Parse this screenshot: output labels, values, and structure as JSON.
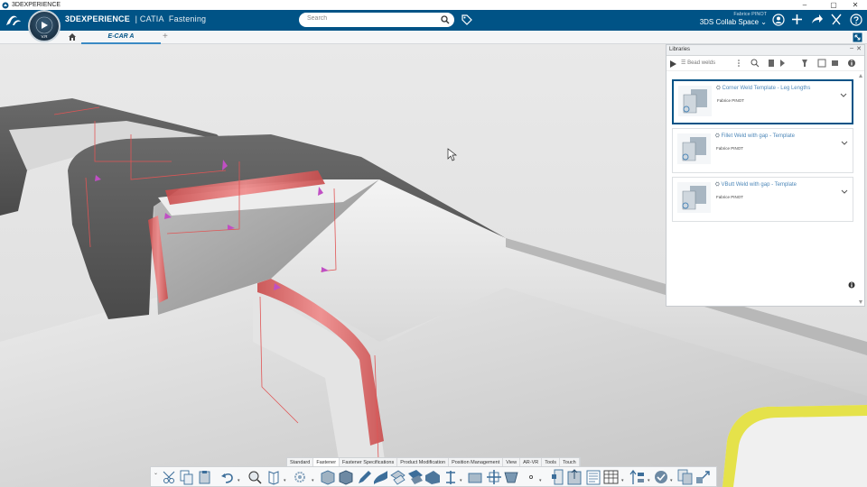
{
  "os_bar": {
    "title": "3DEXPERIENCE",
    "controls": [
      "–",
      "▢",
      "✕"
    ]
  },
  "header": {
    "brand_3d": "3D",
    "brand_experience": "EXPERIENCE",
    "brand_app": "| CATIA",
    "brand_module": "Fastening",
    "compass_version": "V.R",
    "search_placeholder": "Search",
    "user_name": "Fabrice PINOT",
    "collab_space": "3DS Collab Space",
    "icons": [
      "user-icon",
      "add-icon",
      "share-icon",
      "tools-icon",
      "help-icon"
    ]
  },
  "tabs": {
    "active": "E-CAR A",
    "add_symbol": "+"
  },
  "libraries": {
    "title": "Libraries",
    "filter_label": "Bead welds",
    "items": [
      {
        "title": "Corner Weld Template - Leg Lengths",
        "owner": "Fabrice PINOT",
        "selected": true
      },
      {
        "title": "Fillet Weld with gap - Template",
        "owner": "Fabrice PINOT",
        "selected": false
      },
      {
        "title": "VButt Weld with gap - Template",
        "owner": "Fabrice PINOT",
        "selected": false
      }
    ]
  },
  "action_bar": {
    "tabs": [
      "Standard",
      "Fastener",
      "Fastener Specifications",
      "Product Modification",
      "Position Management",
      "View",
      "AR-VR",
      "Tools",
      "Touch"
    ],
    "active_tab": "Fastener"
  },
  "colors": {
    "header_bg": "#005386",
    "accent": "#3a8ac4",
    "weld": "#e06a6a",
    "highlight": "#e5e24a"
  }
}
